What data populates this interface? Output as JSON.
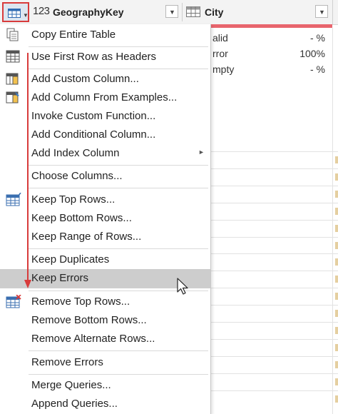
{
  "header": {
    "col1_type_icon": "123",
    "col1_name": "GeographyKey",
    "col2_name": "City"
  },
  "stats": {
    "valid_label": "alid",
    "valid_value": "- %",
    "error_label": "rror",
    "error_value": "100%",
    "empty_label": "mpty",
    "empty_value": "- %"
  },
  "menu": {
    "items": [
      {
        "label": "Copy Entire Table",
        "icon": "copy-table-icon"
      },
      {
        "label": "Use First Row as Headers",
        "icon": "table-headers-icon"
      },
      {
        "label": "Add Custom Column...",
        "icon": "custom-column-icon"
      },
      {
        "label": "Add Column From Examples...",
        "icon": "column-examples-icon"
      },
      {
        "label": "Invoke Custom Function..."
      },
      {
        "label": "Add Conditional Column..."
      },
      {
        "label": "Add Index Column",
        "submenu": true
      },
      {
        "label": "Choose Columns..."
      },
      {
        "label": "Keep Top Rows...",
        "icon": "keep-rows-icon"
      },
      {
        "label": "Keep Bottom Rows..."
      },
      {
        "label": "Keep Range of Rows..."
      },
      {
        "label": "Keep Duplicates"
      },
      {
        "label": "Keep Errors",
        "highlighted": true
      },
      {
        "label": "Remove Top Rows...",
        "icon": "remove-rows-icon"
      },
      {
        "label": "Remove Bottom Rows..."
      },
      {
        "label": "Remove Alternate Rows..."
      },
      {
        "label": "Remove Errors"
      },
      {
        "label": "Merge Queries..."
      },
      {
        "label": "Append Queries..."
      }
    ]
  },
  "colors": {
    "highlight": "#cdcdcd",
    "accent_red": "#d83b3b",
    "error_bar": "#e8656d"
  }
}
